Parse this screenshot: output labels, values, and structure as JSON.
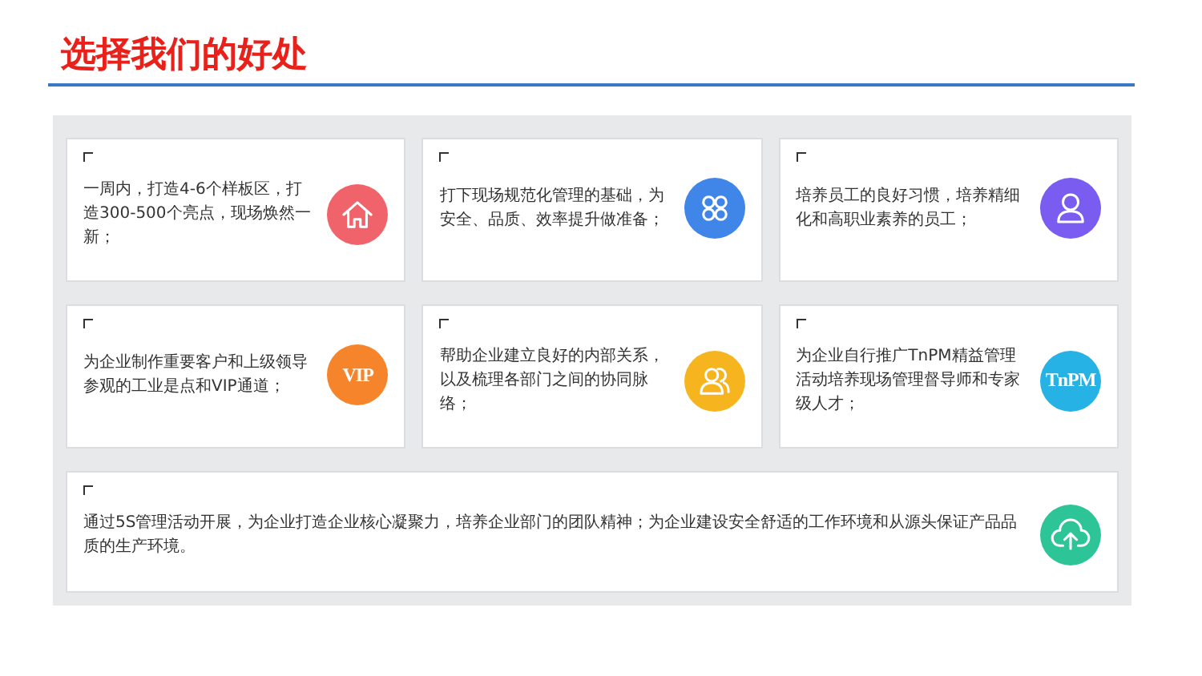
{
  "title": "选择我们的好处",
  "cards": [
    {
      "text": "一周内，打造4-6个样板区，打造300-500个亮点，现场焕然一新；",
      "kind": "house",
      "color": "#f0636b"
    },
    {
      "text": "打下现场规范化管理的基础，为安全、品质、效率提升做准备；",
      "kind": "grid",
      "color": "#3f86e8"
    },
    {
      "text": "培养员工的良好习惯，培养精细化和高职业素养的员工；",
      "kind": "person",
      "color": "#7a5cf0"
    },
    {
      "text": "为企业制作重要客户和上级领导参观的工业是点和VIP通道；",
      "kind": "badge",
      "badge": "VIP",
      "color": "#f5842a"
    },
    {
      "text": "帮助企业建立良好的内部关系，以及梳理各部门之间的协同脉络；",
      "kind": "users",
      "color": "#f6b51e"
    },
    {
      "text": "为企业自行推广TnPM精益管理活动培养现场管理督导师和专家级人才；",
      "kind": "badge",
      "badge": "TnPM",
      "color": "#27b2e6"
    },
    {
      "text": "通过5S管理活动开展，为企业打造企业核心凝聚力，培养企业部门的团队精神；为企业建设安全舒适的工作环境和从源头保证产品品质的生产环境。",
      "kind": "cloud",
      "color": "#2dc597"
    }
  ]
}
